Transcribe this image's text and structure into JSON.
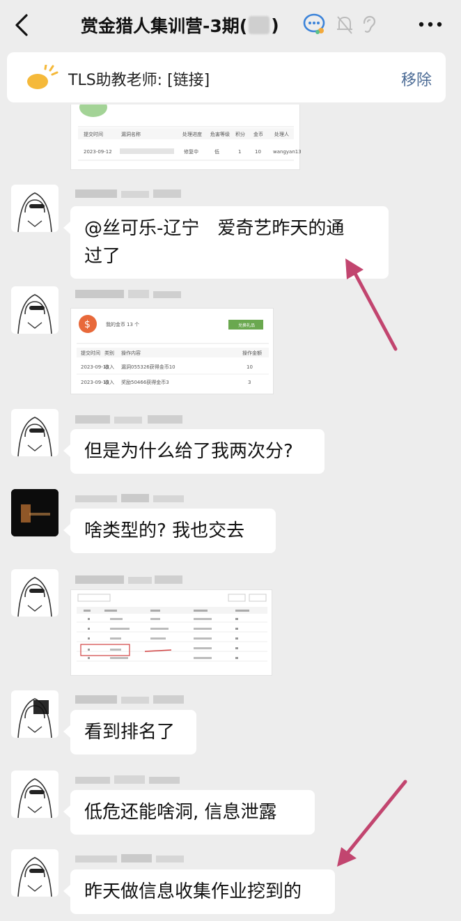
{
  "header": {
    "title_prefix": "赏金猎人集训营-3期(",
    "title_suffix": ")",
    "back_icon": "chevron-left-icon",
    "more_icon": "more-dots-icon"
  },
  "notice": {
    "text": "TLS助教老师: [链接]",
    "remove_label": "移除",
    "icon": "megaphone-icon"
  },
  "messages": [
    {
      "type": "image",
      "desc": "ticket-table-screenshot"
    },
    {
      "type": "text",
      "text": "@丝可乐-辽宁　爱奇艺昨天的通过了"
    },
    {
      "type": "image",
      "desc": "coin-record-screenshot"
    },
    {
      "type": "text",
      "text": "但是为什么给了我两次分?"
    },
    {
      "type": "text",
      "text": "啥类型的? 我也交去"
    },
    {
      "type": "image",
      "desc": "ranking-table-screenshot"
    },
    {
      "type": "text",
      "text": "看到排名了"
    },
    {
      "type": "text",
      "text": "低危还能啥洞, 信息泄露"
    },
    {
      "type": "text",
      "text": "昨天做信息收集作业挖到的"
    }
  ],
  "msg_lines": {
    "m1_line1": "@丝可乐-辽宁　爱奇艺昨天的通",
    "m1_line2": "过了"
  },
  "screens": {
    "ticket": {
      "headers": [
        "提交时间",
        "漏洞名称",
        "处理进度",
        "危害等级",
        "积分",
        "金币",
        "处理人"
      ],
      "row": [
        "2023-09-12",
        "",
        "修复中",
        "低",
        "1",
        "10",
        "wangyan13"
      ]
    },
    "coins": {
      "title": "我的金币",
      "count": "13 个",
      "button": "兑换礼品",
      "headers": [
        "提交时间",
        "类别",
        "操作内容",
        "操作金额"
      ],
      "rows": [
        [
          "2023-09-13",
          "收入",
          "漏洞055326获得金币10",
          "10"
        ],
        [
          "2023-09-13",
          "收入",
          "奖励50466获得金币3",
          "3"
        ]
      ]
    }
  },
  "colors": {
    "bg": "#ededed",
    "bubble": "#ffffff",
    "arrow": "#c2456f",
    "remove": "#4b6b95",
    "coin": "#e8693a",
    "button": "#6aa84f"
  }
}
